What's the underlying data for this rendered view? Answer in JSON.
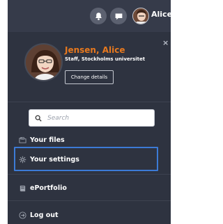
{
  "header": {
    "user_name": "Alice",
    "icons": [
      "bell-icon",
      "chat-icon"
    ]
  },
  "profile": {
    "name": "Jensen, Alice",
    "organization": "Staff, Stockholms universitet",
    "change_details_label": "Change details",
    "name_color": "#e8791e"
  },
  "close_icon": "×",
  "search": {
    "placeholder": "Search",
    "value": ""
  },
  "menu": {
    "items": [
      {
        "label": "Your files",
        "icon": "folder-icon"
      },
      {
        "label": "Your settings",
        "icon": "gear-icon",
        "highlighted": true
      },
      {
        "label": "ePortfolio",
        "icon": "book-icon"
      },
      {
        "label": "Log out",
        "icon": "logout-icon"
      }
    ]
  },
  "colors": {
    "panel_bg": "#2e3340",
    "highlight_border": "#3c7bd6"
  }
}
